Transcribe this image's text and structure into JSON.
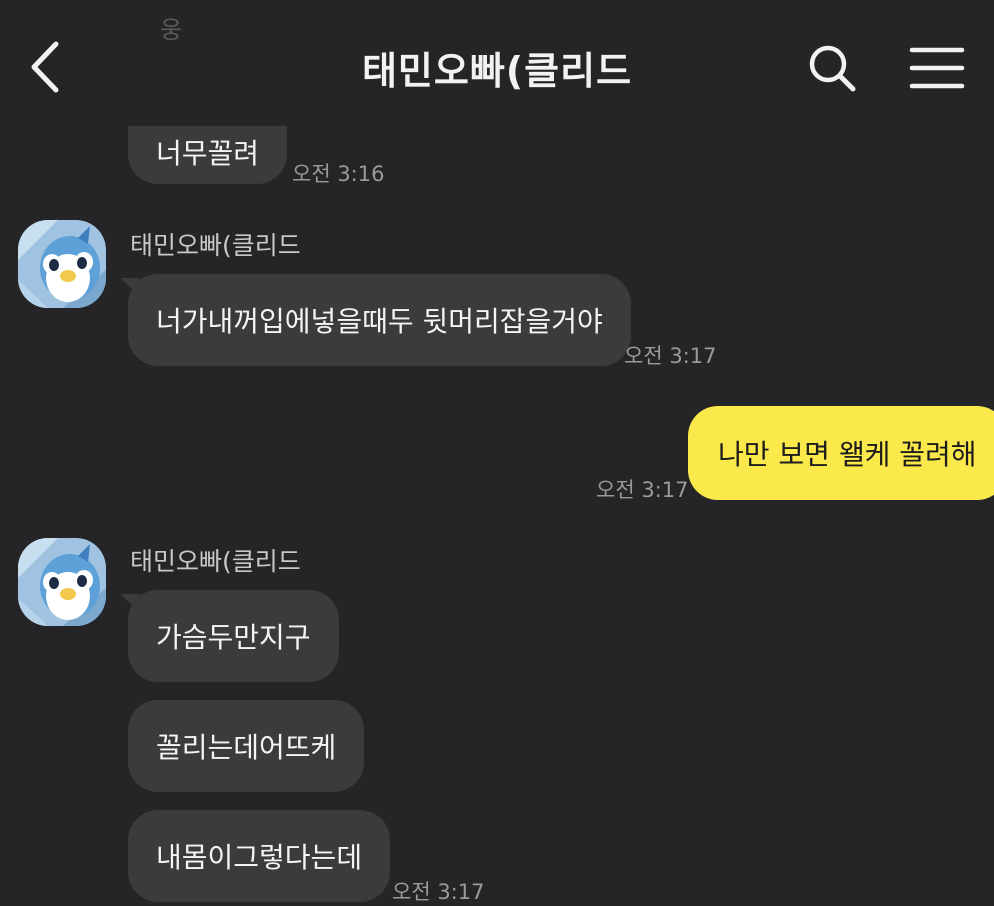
{
  "header": {
    "title": "태민오빠(클리드",
    "back_icon": "chevron-left-icon",
    "search_icon": "search-icon",
    "menu_icon": "hamburger-menu-icon"
  },
  "top_remnant": {
    "text": "웅"
  },
  "messages": [
    {
      "side": "received",
      "text": "너무꼴려",
      "time": "오전 3:16"
    },
    {
      "side": "received",
      "sender": "태민오빠(클리드",
      "text": "너가내꺼입에넣을때두 뒷머리잡을거야",
      "time": "오전 3:17"
    },
    {
      "side": "sent",
      "text": "나만 보면 왤케 꼴려해",
      "time": "오전 3:17"
    },
    {
      "side": "received",
      "sender": "태민오빠(클리드",
      "text": "가슴두만지구"
    },
    {
      "side": "received",
      "text": "꼴리는데어뜨케"
    },
    {
      "side": "received",
      "text": "내몸이그렇다는데",
      "time": "오전 3:17"
    }
  ],
  "colors": {
    "background": "#252527",
    "received_bubble": "#3b3b3d",
    "sent_bubble": "#fbe84a",
    "timestamp": "#9a9a9a"
  }
}
